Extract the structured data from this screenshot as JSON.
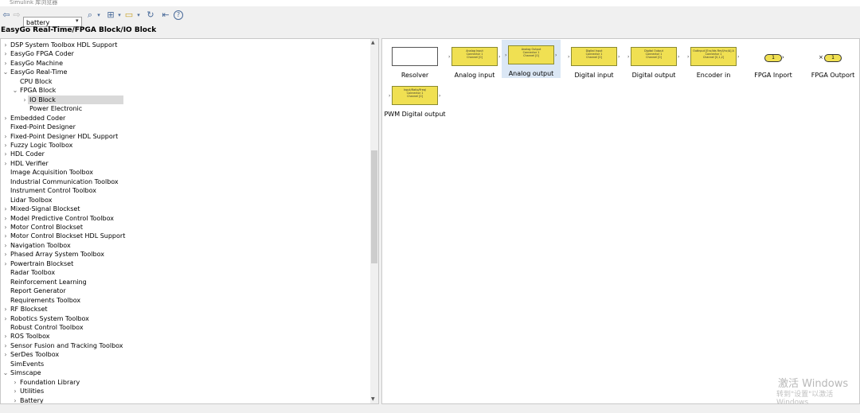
{
  "window": {
    "title": "Simulink 库浏览器"
  },
  "toolbar": {
    "search_value": "battery"
  },
  "breadcrumb": "EasyGo Real-Time/FPGA Block/IO Block",
  "tree": [
    {
      "label": "DSP System Toolbox HDL Support",
      "level": 0,
      "expander": "›"
    },
    {
      "label": "EasyGo FPGA Coder",
      "level": 0,
      "expander": "›"
    },
    {
      "label": "EasyGo Machine",
      "level": 0,
      "expander": "›"
    },
    {
      "label": "EasyGo Real-Time",
      "level": 0,
      "expander": "⌄"
    },
    {
      "label": "CPU Block",
      "level": 1,
      "expander": ""
    },
    {
      "label": "FPGA Block",
      "level": 1,
      "expander": "⌄"
    },
    {
      "label": "IO Block",
      "level": 2,
      "expander": "›",
      "selected": true
    },
    {
      "label": "Power Electronic",
      "level": 2,
      "expander": ""
    },
    {
      "label": "Embedded Coder",
      "level": 0,
      "expander": "›"
    },
    {
      "label": "Fixed-Point Designer",
      "level": 0,
      "expander": ""
    },
    {
      "label": "Fixed-Point Designer HDL Support",
      "level": 0,
      "expander": "›"
    },
    {
      "label": "Fuzzy Logic Toolbox",
      "level": 0,
      "expander": "›"
    },
    {
      "label": "HDL Coder",
      "level": 0,
      "expander": "›"
    },
    {
      "label": "HDL Verifier",
      "level": 0,
      "expander": "›"
    },
    {
      "label": "Image Acquisition Toolbox",
      "level": 0,
      "expander": ""
    },
    {
      "label": "Industrial Communication Toolbox",
      "level": 0,
      "expander": ""
    },
    {
      "label": "Instrument Control Toolbox",
      "level": 0,
      "expander": ""
    },
    {
      "label": "Lidar Toolbox",
      "level": 0,
      "expander": ""
    },
    {
      "label": "Mixed-Signal Blockset",
      "level": 0,
      "expander": "›"
    },
    {
      "label": "Model Predictive Control Toolbox",
      "level": 0,
      "expander": "›"
    },
    {
      "label": "Motor Control Blockset",
      "level": 0,
      "expander": "›"
    },
    {
      "label": "Motor Control Blockset HDL Support",
      "level": 0,
      "expander": "›"
    },
    {
      "label": "Navigation Toolbox",
      "level": 0,
      "expander": "›"
    },
    {
      "label": "Phased Array System Toolbox",
      "level": 0,
      "expander": "›"
    },
    {
      "label": "Powertrain Blockset",
      "level": 0,
      "expander": "›"
    },
    {
      "label": "Radar Toolbox",
      "level": 0,
      "expander": ""
    },
    {
      "label": "Reinforcement Learning",
      "level": 0,
      "expander": ""
    },
    {
      "label": "Report Generator",
      "level": 0,
      "expander": ""
    },
    {
      "label": "Requirements Toolbox",
      "level": 0,
      "expander": ""
    },
    {
      "label": "RF Blockset",
      "level": 0,
      "expander": "›"
    },
    {
      "label": "Robotics System Toolbox",
      "level": 0,
      "expander": "›"
    },
    {
      "label": "Robust Control Toolbox",
      "level": 0,
      "expander": ""
    },
    {
      "label": "ROS Toolbox",
      "level": 0,
      "expander": "›"
    },
    {
      "label": "Sensor Fusion and Tracking Toolbox",
      "level": 0,
      "expander": "›"
    },
    {
      "label": "SerDes Toolbox",
      "level": 0,
      "expander": "›"
    },
    {
      "label": "SimEvents",
      "level": 0,
      "expander": ""
    },
    {
      "label": "Simscape",
      "level": 0,
      "expander": "⌄"
    },
    {
      "label": "Foundation Library",
      "level": 1,
      "expander": "›"
    },
    {
      "label": "Utilities",
      "level": 1,
      "expander": "›"
    },
    {
      "label": "Battery",
      "level": 1,
      "expander": "›"
    }
  ],
  "blocks": [
    {
      "name": "Resolver",
      "inner": "",
      "style": "white"
    },
    {
      "name": "Analog input",
      "inner": "Analog Input\nConnector 1\nChannel [0]",
      "style": "yellow"
    },
    {
      "name": "Analog output",
      "inner": "Analog Output\nConnector 1\nChannel [0]",
      "style": "yellow",
      "selected": true
    },
    {
      "name": "Digital input",
      "inner": "Digital Input\nConnector 1\nChannel [0]",
      "style": "yellow"
    },
    {
      "name": "Digital output",
      "inner": "Digital Output\nConnector 1\nChannel [0]",
      "style": "yellow"
    },
    {
      "name": "Encoder in",
      "inner": "OutInput [Enc/Ids Rm/I/nc/A] A\nConnector 1\nChannel [0,1,2]",
      "style": "yellow"
    },
    {
      "name": "FPGA Inport",
      "inner": "1",
      "style": "inport"
    },
    {
      "name": "FPGA Outport",
      "inner": "1",
      "style": "outport"
    },
    {
      "name": "PWM Digital output",
      "inner": "Input/Ratio/Freq/\nConnector 1\nChannel [0]",
      "style": "yellow"
    }
  ],
  "watermark": {
    "line1": "激活 Windows",
    "line2": "转到\"设置\"以激活 Windows"
  }
}
